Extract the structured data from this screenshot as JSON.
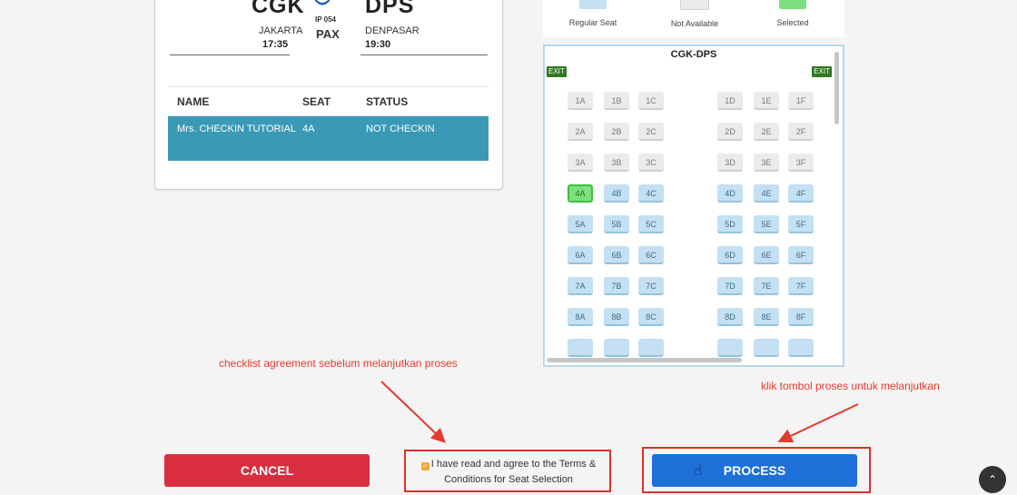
{
  "flight": {
    "origin_code": "CGK",
    "origin_city": "JAKARTA",
    "origin_time": "17:35",
    "dest_code": "DPS",
    "dest_city": "DENPASAR",
    "dest_time": "19:30",
    "flight_no": "IP 054",
    "pax_label": "PAX"
  },
  "passenger_table": {
    "headers": [
      "NAME",
      "SEAT",
      "STATUS"
    ],
    "rows": [
      {
        "name": "Mrs. CHECKIN TUTORIAL",
        "seat": "4A",
        "status": "NOT CHECKIN"
      }
    ]
  },
  "legend": {
    "items": [
      "Regular Seat",
      "Not Available",
      "Selected"
    ],
    "colors": {
      "regular": "#c4e0f2",
      "not_available": "#ebebeb",
      "selected": "#7ce07c"
    }
  },
  "seatmap": {
    "title": "CGK-DPS",
    "exit_label": "EXIT",
    "rows": [
      {
        "seats": [
          "1A",
          "1B",
          "1C",
          "1D",
          "1E",
          "1F"
        ],
        "status": "unavailable"
      },
      {
        "seats": [
          "2A",
          "2B",
          "2C",
          "2D",
          "2E",
          "2F"
        ],
        "status": "unavailable"
      },
      {
        "seats": [
          "3A",
          "3B",
          "3C",
          "3D",
          "3E",
          "3F"
        ],
        "status": "unavailable"
      },
      {
        "seats": [
          "4A",
          "4B",
          "4C",
          "4D",
          "4E",
          "4F"
        ],
        "status": "regular"
      },
      {
        "seats": [
          "5A",
          "5B",
          "5C",
          "5D",
          "5E",
          "5F"
        ],
        "status": "regular"
      },
      {
        "seats": [
          "6A",
          "6B",
          "6C",
          "6D",
          "6E",
          "6F"
        ],
        "status": "regular"
      },
      {
        "seats": [
          "7A",
          "7B",
          "7C",
          "7D",
          "7E",
          "7F"
        ],
        "status": "regular"
      },
      {
        "seats": [
          "8A",
          "8B",
          "8C",
          "8D",
          "8E",
          "8F"
        ],
        "status": "regular"
      }
    ],
    "selected_seat": "4A"
  },
  "annotations": {
    "agreement_note": "checklist agreement sebelum melanjutkan proses",
    "process_note": "klik tombol proses untuk melanjutkan"
  },
  "actions": {
    "cancel_label": "CANCEL",
    "process_label": "PROCESS",
    "agree_text": "I have read and agree to the Terms & Conditions for Seat Selection",
    "agree_checked": true
  },
  "icons": {
    "scroll_top": "chevron-up-icon",
    "cursor": "hand-pointer-icon",
    "airline": "airline-logo-icon"
  }
}
